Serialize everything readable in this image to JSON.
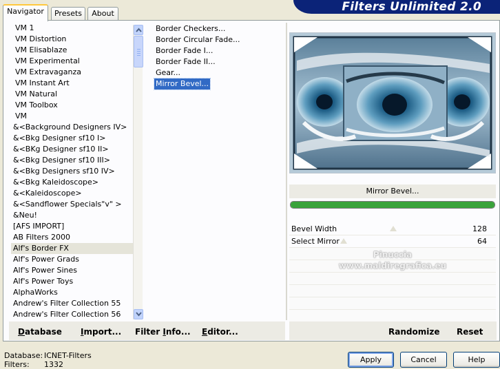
{
  "tabs": [
    {
      "label": "Navigator",
      "active": true
    },
    {
      "label": "Presets",
      "active": false
    },
    {
      "label": "About",
      "active": false
    }
  ],
  "app_title": "Filters Unlimited 2.0",
  "categories": [
    "VM 1",
    "VM Distortion",
    "VM Elisablaze",
    "VM Experimental",
    "VM Extravaganza",
    "VM Instant Art",
    "VM Natural",
    "VM Toolbox",
    "VM",
    "&<Background Designers IV>",
    "&<Bkg Designer sf10 I>",
    "&<BKg Designer sf10 II>",
    "&<Bkg Designer sf10 III>",
    "&<Bkg Designers sf10 IV>",
    "&<Bkg Kaleidoscope>",
    "&<Kaleidoscope>",
    "&<Sandflower Specials\"v\" >",
    "&Neu!",
    "[AFS IMPORT]",
    "AB Filters 2000",
    "Alf's Border FX",
    "Alf's Power Grads",
    "Alf's Power Sines",
    "Alf's Power Toys",
    "AlphaWorks",
    "Andrew's Filter Collection 55",
    "Andrew's Filter Collection 56"
  ],
  "selected_category": "Alf's Border FX",
  "filters": [
    "Border Checkers...",
    "Border Circular Fade...",
    "Border Fade I...",
    "Border Fade II...",
    "Gear...",
    "Mirror Bevel..."
  ],
  "selected_filter": "Mirror Bevel...",
  "filter_name": "Mirror Bevel...",
  "progress": 1.0,
  "params": [
    {
      "label": "Bevel Width",
      "value": "128"
    },
    {
      "label": "Select Mirror",
      "value": "64"
    }
  ],
  "watermark": {
    "line1": "Pinuccia",
    "line2": "www.maldiregrafica.eu"
  },
  "commands": {
    "database_u": "D",
    "database_rest": "atabase",
    "import_u": "I",
    "import_rest": "mport...",
    "filter_info_pre": "Filter ",
    "filter_info_u": "I",
    "filter_info_rest": "nfo...",
    "editor_u": "E",
    "editor_rest": "ditor...",
    "randomize": "Randomize",
    "reset": "Reset"
  },
  "footer": {
    "database_label": "Database:",
    "database_value": "ICNET-Filters",
    "filters_label": "Filters:",
    "filters_value": "1332"
  },
  "buttons": {
    "apply": "Apply",
    "cancel": "Cancel",
    "help": "Help"
  },
  "colors": {
    "banner": "#0b2378",
    "selection": "#316ac5"
  }
}
